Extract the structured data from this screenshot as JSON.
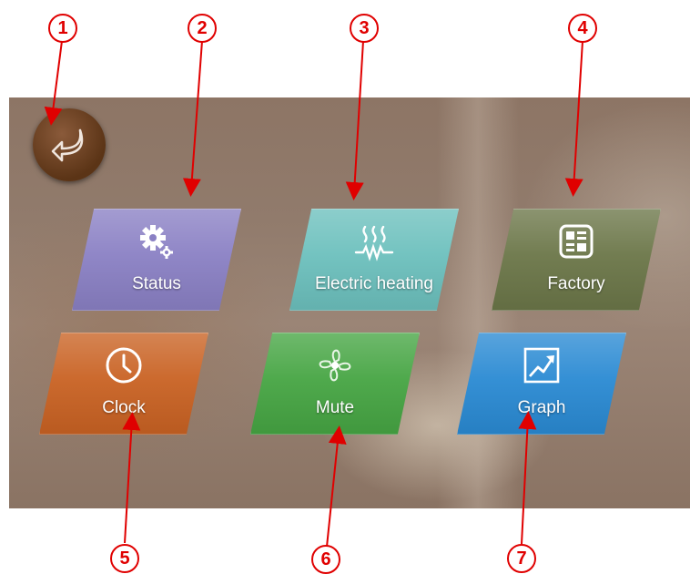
{
  "tiles": [
    {
      "id": "status",
      "label": "Status",
      "icon": "gears-icon",
      "color": "#8d83c6"
    },
    {
      "id": "electric-heating",
      "label": "Electric heating",
      "icon": "heating-coil-icon",
      "color": "#72c4c1"
    },
    {
      "id": "factory",
      "label": "Factory",
      "icon": "factory-panel-icon",
      "color": "#6f7a4c"
    },
    {
      "id": "clock",
      "label": "Clock",
      "icon": "clock-icon",
      "color": "#cf6a27"
    },
    {
      "id": "mute",
      "label": "Mute",
      "icon": "fan-icon",
      "color": "#4bab47"
    },
    {
      "id": "graph",
      "label": "Graph",
      "icon": "graph-icon",
      "color": "#2b8fd6"
    }
  ],
  "back_button": {
    "icon": "back-arrow-icon"
  },
  "annotations": [
    "1",
    "2",
    "3",
    "4",
    "5",
    "6",
    "7"
  ]
}
